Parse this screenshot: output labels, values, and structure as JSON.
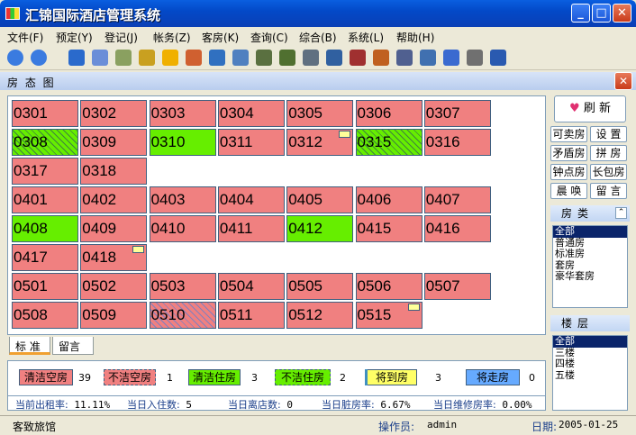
{
  "window": {
    "title": "汇锦国际酒店管理系统"
  },
  "menu": [
    "文件(F)",
    "预定(Y)",
    "登记(J)",
    "帐务(Z)",
    "客房(K)",
    "查询(C)",
    "综合(B)",
    "系统(L)",
    "帮助(H)"
  ],
  "panel": {
    "title": "房 态 图"
  },
  "rooms": [
    {
      "no": "0301",
      "status": "dirty-vacant"
    },
    {
      "no": "0302",
      "status": "dirty-vacant"
    },
    {
      "no": "0303",
      "status": "dirty-vacant"
    },
    {
      "no": "0304",
      "status": "dirty-vacant"
    },
    {
      "no": "0305",
      "status": "dirty-vacant"
    },
    {
      "no": "0306",
      "status": "dirty-vacant"
    },
    {
      "no": "0307",
      "status": "dirty-vacant"
    },
    {
      "no": "0308",
      "status": "clean-occupied-hatched"
    },
    {
      "no": "0309",
      "status": "dirty-vacant"
    },
    {
      "no": "0310",
      "status": "clean-occupied"
    },
    {
      "no": "0311",
      "status": "dirty-vacant"
    },
    {
      "no": "0312",
      "status": "dirty-vacant-note"
    },
    {
      "no": "0315",
      "status": "clean-occupied-hatched"
    },
    {
      "no": "0316",
      "status": "dirty-vacant"
    },
    {
      "no": "0317",
      "status": "dirty-vacant"
    },
    {
      "no": "0318",
      "status": "dirty-vacant"
    },
    {
      "no": "0401",
      "status": "dirty-vacant"
    },
    {
      "no": "0402",
      "status": "dirty-vacant"
    },
    {
      "no": "0403",
      "status": "dirty-vacant"
    },
    {
      "no": "0404",
      "status": "dirty-vacant"
    },
    {
      "no": "0405",
      "status": "dirty-vacant"
    },
    {
      "no": "0406",
      "status": "dirty-vacant"
    },
    {
      "no": "0407",
      "status": "dirty-vacant"
    },
    {
      "no": "0408",
      "status": "clean-occupied"
    },
    {
      "no": "0409",
      "status": "dirty-vacant"
    },
    {
      "no": "0410",
      "status": "dirty-vacant"
    },
    {
      "no": "0411",
      "status": "dirty-vacant"
    },
    {
      "no": "0412",
      "status": "clean-occupied"
    },
    {
      "no": "0415",
      "status": "dirty-vacant"
    },
    {
      "no": "0416",
      "status": "dirty-vacant"
    },
    {
      "no": "0417",
      "status": "dirty-vacant"
    },
    {
      "no": "0418",
      "status": "dirty-vacant-note"
    },
    {
      "no": "0501",
      "status": "dirty-vacant"
    },
    {
      "no": "0502",
      "status": "dirty-vacant"
    },
    {
      "no": "0503",
      "status": "dirty-vacant"
    },
    {
      "no": "0504",
      "status": "dirty-vacant"
    },
    {
      "no": "0505",
      "status": "dirty-vacant"
    },
    {
      "no": "0506",
      "status": "dirty-vacant"
    },
    {
      "no": "0507",
      "status": "dirty-vacant"
    },
    {
      "no": "0508",
      "status": "dirty-vacant"
    },
    {
      "no": "0509",
      "status": "dirty-vacant"
    },
    {
      "no": "0510",
      "status": "dirty-vacant-hatched"
    },
    {
      "no": "0511",
      "status": "dirty-vacant"
    },
    {
      "no": "0512",
      "status": "dirty-vacant"
    },
    {
      "no": "0515",
      "status": "dirty-vacant-note"
    }
  ],
  "tabs": [
    "标 准",
    "留言"
  ],
  "legend": [
    {
      "label": "清洁空房",
      "count": "39",
      "color": "#f08080"
    },
    {
      "label": "不洁空房",
      "count": "1",
      "color": "#f08080"
    },
    {
      "label": "清洁住房",
      "count": "3",
      "color": "#66ee00"
    },
    {
      "label": "不洁住房",
      "count": "2",
      "color": "#66ee00"
    },
    {
      "label": "将到房",
      "count": "3",
      "color": "#ffff66"
    },
    {
      "label": "将走房",
      "count": "0",
      "color": "#66aaff"
    }
  ],
  "stats": [
    {
      "label": "当前出租率:",
      "value": "11.11%"
    },
    {
      "label": "当日入住数:",
      "value": "5"
    },
    {
      "label": "当日离店数:",
      "value": "0"
    },
    {
      "label": "当日脏房率:",
      "value": "6.67%"
    },
    {
      "label": "当日维修房率:",
      "value": "0.00%"
    }
  ],
  "right": {
    "refresh": "刷 新",
    "buttons": [
      "可卖房",
      "设 置",
      "矛盾房",
      "拼 房",
      "钟点房",
      "长包房",
      "晨 唤",
      "留 言"
    ],
    "room_type_title": "房类",
    "room_types": [
      "全部",
      "普通房",
      "标准房",
      "套房",
      "豪华套房"
    ],
    "floor_title": "楼层",
    "floors": [
      "全部",
      "三楼",
      "四楼",
      "五楼"
    ]
  },
  "status": {
    "company": "客致旅馆",
    "operator_label": "操作员:",
    "operator": "admin",
    "date_label": "日期:",
    "date": "2005-01-25"
  }
}
